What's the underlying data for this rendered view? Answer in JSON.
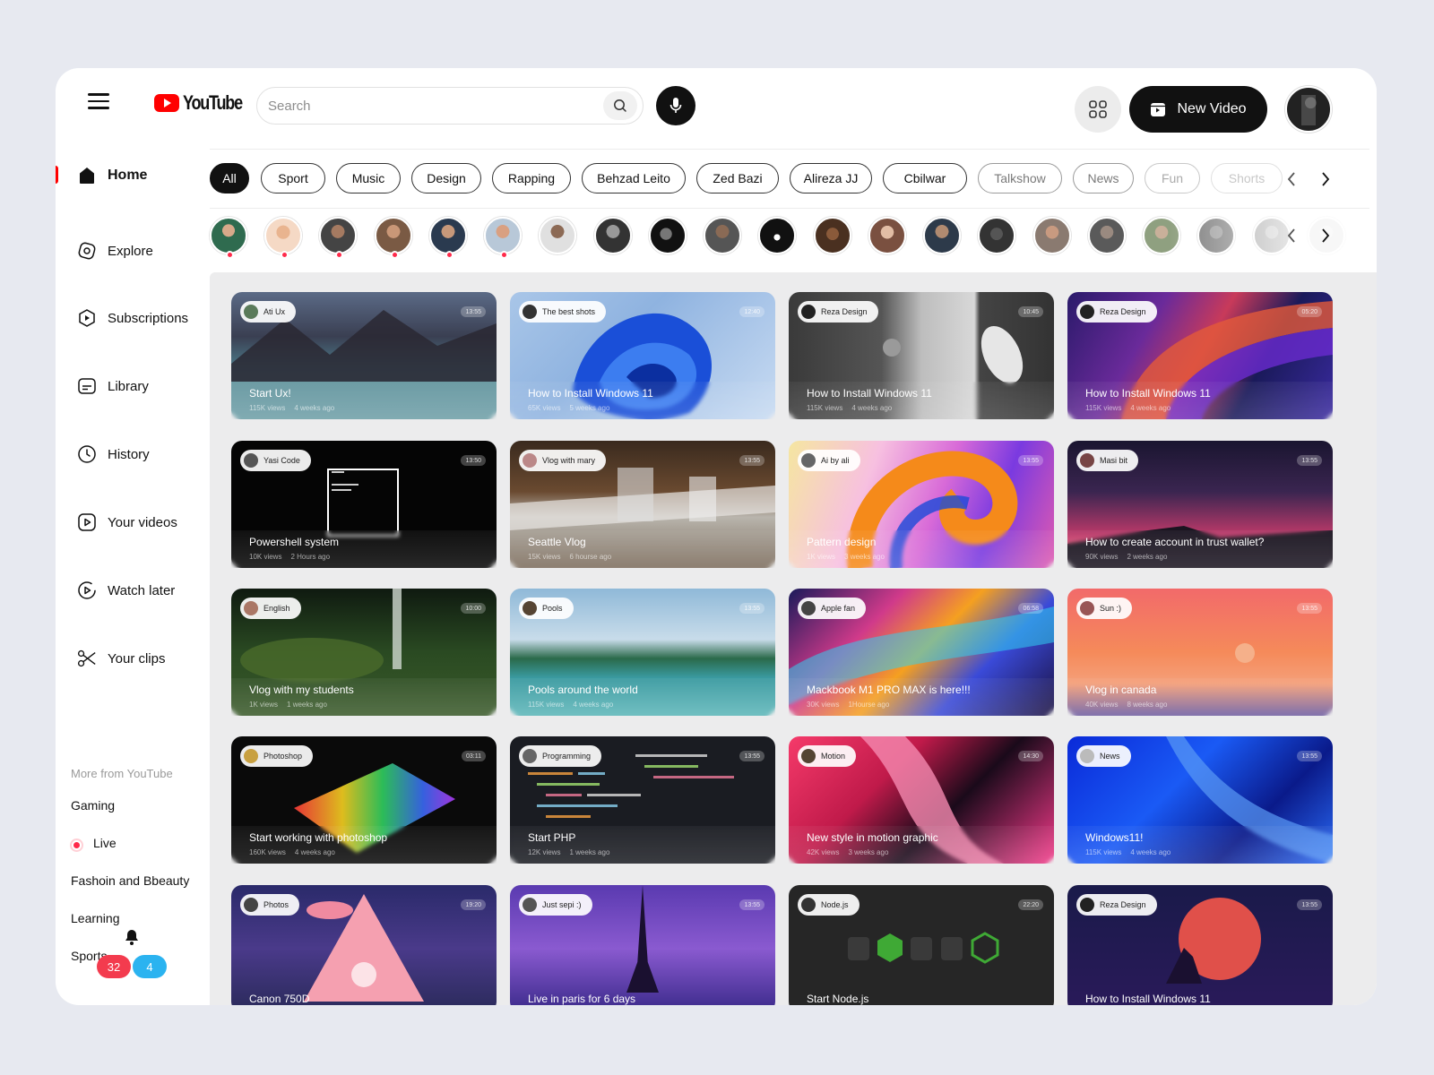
{
  "header": {
    "logo_text": "YouTube",
    "search_placeholder": "Search",
    "new_video_label": "New Video"
  },
  "sidebar": {
    "items": [
      {
        "label": "Home",
        "icon": "home-icon",
        "active": true
      },
      {
        "label": "Explore",
        "icon": "explore-icon"
      },
      {
        "label": "Subscriptions",
        "icon": "subscriptions-icon"
      },
      {
        "label": "Library",
        "icon": "library-icon"
      },
      {
        "label": "History",
        "icon": "history-icon"
      },
      {
        "label": "Your videos",
        "icon": "your-videos-icon"
      },
      {
        "label": "Watch later",
        "icon": "watch-later-icon"
      },
      {
        "label": "Your clips",
        "icon": "scissors-icon"
      }
    ],
    "more_title": "More from YouTube",
    "more_items": [
      "Gaming",
      "Live",
      "Fashoin and Bbeauty",
      "Learning",
      "Sports"
    ],
    "notifications": {
      "red_count": "32",
      "blue_count": "4"
    }
  },
  "chips": [
    "All",
    "Sport",
    "Music",
    "Design",
    "Rapping",
    "Behzad Leito",
    "Zed Bazi",
    "Alireza JJ",
    "Cbilwar",
    "Talkshow",
    "News",
    "Fun",
    "Shorts"
  ],
  "videos": [
    {
      "channel": "Ati Ux",
      "duration": "13:55",
      "title": "Start Ux!",
      "views": "115K views",
      "ago": "4 weeks ago"
    },
    {
      "channel": "The best shots",
      "duration": "12:40",
      "title": "How to Install Windows 11",
      "views": "65K views",
      "ago": "5 weeks ago"
    },
    {
      "channel": "Reza Design",
      "duration": "10:45",
      "title": "How to Install Windows 11",
      "views": "115K views",
      "ago": "4 weeks ago"
    },
    {
      "channel": "Reza Design",
      "duration": "05:20",
      "title": "How to Install Windows 11",
      "views": "115K views",
      "ago": "4 weeks ago"
    },
    {
      "channel": "Yasi Code",
      "duration": "13:50",
      "title": "Powershell system",
      "views": "10K views",
      "ago": "2 Hours ago"
    },
    {
      "channel": "Vlog with mary",
      "duration": "13:55",
      "title": "Seattle Vlog",
      "views": "15K views",
      "ago": "6 hourse ago"
    },
    {
      "channel": "Ai by ali",
      "duration": "13:55",
      "title": "Pattern design",
      "views": "1K views",
      "ago": "3 weeks ago"
    },
    {
      "channel": "Masi bit",
      "duration": "13:55",
      "title": "How to create account in trust wallet?",
      "views": "90K views",
      "ago": "2 weeks ago"
    },
    {
      "channel": "English",
      "duration": "10:00",
      "title": "Vlog with my students",
      "views": "1K views",
      "ago": "1 weeks ago"
    },
    {
      "channel": "Pools",
      "duration": "13:55",
      "title": "Pools around the world",
      "views": "115K views",
      "ago": "4 weeks ago"
    },
    {
      "channel": "Apple fan",
      "duration": "06:58",
      "title": "Mackbook M1 PRO MAX is here!!!",
      "views": "30K views",
      "ago": "1Hourse ago"
    },
    {
      "channel": "Sun :)",
      "duration": "13:55",
      "title": "Vlog in canada",
      "views": "40K views",
      "ago": "8 weeks ago"
    },
    {
      "channel": "Photoshop",
      "duration": "03:11",
      "title": "Start working with photoshop",
      "views": "160K views",
      "ago": "4 weeks ago"
    },
    {
      "channel": "Programming",
      "duration": "13:55",
      "title": "Start PHP",
      "views": "12K views",
      "ago": "1 weeks ago"
    },
    {
      "channel": "Motion",
      "duration": "14:30",
      "title": "New style in motion graphic",
      "views": "42K views",
      "ago": "3 weeks ago"
    },
    {
      "channel": "News",
      "duration": "13:55",
      "title": "Windows11!",
      "views": "115K views",
      "ago": "4 weeks ago"
    },
    {
      "channel": "Photos",
      "duration": "19:20",
      "title": "Canon 750D",
      "views": "",
      "ago": ""
    },
    {
      "channel": "Just sepi :)",
      "duration": "13:55",
      "title": "Live in paris for 6 days",
      "views": "",
      "ago": ""
    },
    {
      "channel": "Node.js",
      "duration": "22:20",
      "title": "Start Node.js",
      "views": "",
      "ago": ""
    },
    {
      "channel": "Reza Design",
      "duration": "13:55",
      "title": "How to Install Windows 11",
      "views": "",
      "ago": ""
    }
  ],
  "colors": {
    "accent": "#ff0000",
    "live": "#ff2a4a",
    "badge_red": "#f33b4e",
    "badge_blue": "#2bb3f0"
  }
}
